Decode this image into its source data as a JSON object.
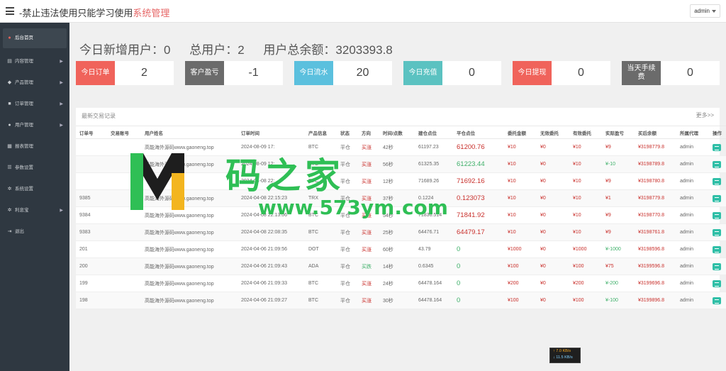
{
  "header": {
    "title_main": "-禁止违法使用只能学习使用",
    "title_accent": "系统管理",
    "admin_label": "admin"
  },
  "sidebar": {
    "items": [
      {
        "label": "后台首页",
        "icon": "dashboard-icon"
      },
      {
        "label": "内容管理",
        "icon": "folder-icon"
      },
      {
        "label": "产品管理",
        "icon": "tag-icon"
      },
      {
        "label": "订单管理",
        "icon": "cart-icon"
      },
      {
        "label": "用户管理",
        "icon": "user-icon"
      },
      {
        "label": "报表管理",
        "icon": "chart-icon"
      },
      {
        "label": "参数设置",
        "icon": "settings-icon"
      },
      {
        "label": "系统设置",
        "icon": "gears-icon"
      },
      {
        "label": "利息宝",
        "icon": "gear-icon"
      },
      {
        "label": "退出",
        "icon": "logout-icon"
      }
    ]
  },
  "stats": {
    "new_users_label": "今日新增用户：",
    "new_users_value": "0",
    "total_users_label": "总用户：",
    "total_users_value": "2",
    "balance_label": "用户总余额：",
    "balance_value": "3203393.8"
  },
  "cards": [
    {
      "label": "今日订单",
      "value": "2",
      "color": "#f0635b"
    },
    {
      "label": "客户盈亏",
      "value": "-1",
      "color": "#6b6b6b"
    },
    {
      "label": "今日流水",
      "value": "20",
      "color": "#5bc0de"
    },
    {
      "label": "今日充值",
      "value": "0",
      "color": "#5bc2c1"
    },
    {
      "label": "今日提现",
      "value": "0",
      "color": "#f0635b"
    },
    {
      "label": "当天手续费",
      "value": "0",
      "color": "#6b6b6b"
    }
  ],
  "panel": {
    "title": "最新交易记录",
    "more": "更多>>"
  },
  "table": {
    "headers": [
      "订单号",
      "交易账号",
      "用户姓名",
      "订单时间",
      "产品信息",
      "状态",
      "方向",
      "时间/点数",
      "建仓点位",
      "平仓点位",
      "委托金额",
      "无效委托",
      "有效委托",
      "实际盈亏",
      "买后余额",
      "所属代理",
      "操作"
    ],
    "rows": [
      [
        "",
        "",
        "高能海外源码www.gaoneng.top",
        "2024-08-09 17:",
        "BTC",
        "平仓",
        "买涨",
        "42秒",
        "61197.23",
        "61200.76",
        "¥10",
        "¥0",
        "¥10",
        "¥9",
        "¥3198779.8",
        "admin"
      ],
      [
        "",
        "",
        "高能海外源码www.gaoneng.top",
        "2024-08-09 12:",
        "BTC",
        "平仓",
        "买涨",
        "56秒",
        "61325.35",
        "61223.44",
        "¥10",
        "¥0",
        "¥10",
        "¥-10",
        "¥3198789.8",
        "admin"
      ],
      [
        "",
        "",
        "",
        "2024-04-08 22:",
        "BTC",
        "平仓",
        "买涨",
        "12秒",
        "71689.26",
        "71692.16",
        "¥10",
        "¥0",
        "¥10",
        "¥9",
        "¥3198780.8",
        "admin"
      ],
      [
        "9385",
        "",
        "高能海外源码www.gaoneng.top",
        "2024-04-08 22:15:23",
        "TRX",
        "平仓",
        "买涨",
        "37秒",
        "0.1224",
        "0.123073",
        "¥10",
        "¥0",
        "¥10",
        "¥1",
        "¥3198779.8",
        "admin"
      ],
      [
        "9384",
        "",
        "高能海外源码www.gaoneng.top",
        "2024-04-08 22:13:06",
        "BTC",
        "平仓",
        "买涨",
        "54秒",
        "71836.514",
        "71841.92",
        "¥10",
        "¥0",
        "¥10",
        "¥9",
        "¥3198770.8",
        "admin"
      ],
      [
        "9383",
        "",
        "高能海外源码www.gaoneng.top",
        "2024-04-08 22:08:35",
        "BTC",
        "平仓",
        "买涨",
        "25秒",
        "64476.71",
        "64479.17",
        "¥10",
        "¥0",
        "¥10",
        "¥9",
        "¥3198761.8",
        "admin"
      ],
      [
        "201",
        "",
        "高能海外源码www.gaoneng.top",
        "2024-04-06 21:09:56",
        "DOT",
        "平仓",
        "买涨",
        "60秒",
        "43.79",
        "0",
        "¥1000",
        "¥0",
        "¥1000",
        "¥-1000",
        "¥3198596.8",
        "admin"
      ],
      [
        "200",
        "",
        "高能海外源码www.gaoneng.top",
        "2024-04-06 21:09:43",
        "ADA",
        "平仓",
        "买跌",
        "14秒",
        "0.6345",
        "0",
        "¥100",
        "¥0",
        "¥100",
        "¥75",
        "¥3199596.8",
        "admin"
      ],
      [
        "199",
        "",
        "高能海外源码www.gaoneng.top",
        "2024-04-06 21:09:33",
        "BTC",
        "平仓",
        "买涨",
        "24秒",
        "64478.164",
        "0",
        "¥200",
        "¥0",
        "¥200",
        "¥-200",
        "¥3199696.8",
        "admin"
      ],
      [
        "198",
        "",
        "高能海外源码www.gaoneng.top",
        "2024-04-06 21:09:27",
        "BTC",
        "平仓",
        "买涨",
        "30秒",
        "64478.164",
        "0",
        "¥100",
        "¥0",
        "¥100",
        "¥-100",
        "¥3199896.8",
        "admin"
      ]
    ],
    "close_price_colors": [
      "red",
      "green",
      "red",
      "red",
      "red",
      "red",
      "green",
      "green",
      "green",
      "green"
    ],
    "direction_colors": [
      "red",
      "red",
      "red",
      "red",
      "red",
      "red",
      "red",
      "green",
      "red",
      "red"
    ],
    "pnl_colors": [
      "red",
      "green",
      "red",
      "red",
      "red",
      "red",
      "green",
      "red",
      "green",
      "green"
    ]
  },
  "watermark": {
    "cn": "码之家",
    "url": "www.573ym.com"
  },
  "netspeed": {
    "up": "↑ 7.0 KB/s",
    "down": "↓ 11.5 KB/s"
  }
}
